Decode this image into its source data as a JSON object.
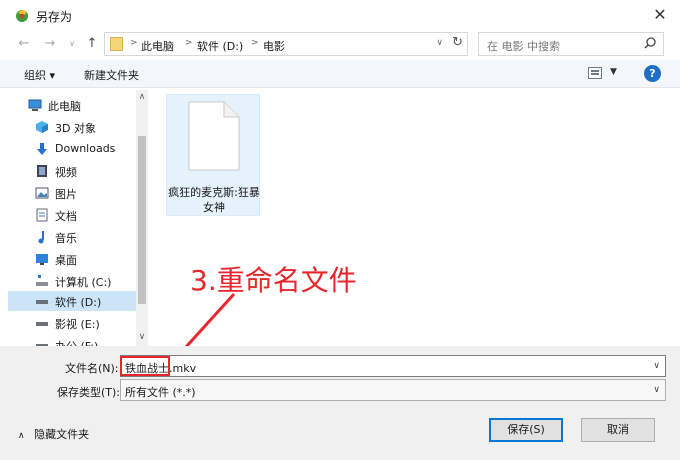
{
  "window": {
    "title": "另存为"
  },
  "address": {
    "crumbs": [
      "此电脑",
      "软件 (D:)",
      "电影"
    ]
  },
  "search": {
    "placeholder": "在 电影 中搜索"
  },
  "toolbar": {
    "organize": "组织 ▾",
    "new_folder": "新建文件夹"
  },
  "sidebar": {
    "items": [
      {
        "label": "此电脑",
        "icon": "computer-icon"
      },
      {
        "label": "3D 对象",
        "icon": "cube-icon"
      },
      {
        "label": "Downloads",
        "icon": "download-arrow-icon"
      },
      {
        "label": "视频",
        "icon": "video-icon"
      },
      {
        "label": "图片",
        "icon": "picture-icon"
      },
      {
        "label": "文档",
        "icon": "document-icon"
      },
      {
        "label": "音乐",
        "icon": "music-note-icon"
      },
      {
        "label": "桌面",
        "icon": "desktop-icon"
      },
      {
        "label": "计算机 (C:)",
        "icon": "drive-c-icon"
      },
      {
        "label": "软件 (D:)",
        "icon": "drive-icon",
        "selected": true
      },
      {
        "label": "影视 (E:)",
        "icon": "drive-icon"
      },
      {
        "label": "办公 (F:)",
        "icon": "drive-icon"
      }
    ]
  },
  "file": {
    "name": "疯狂的麦克斯:狂暴女神"
  },
  "annotation": {
    "text": "3.重命名文件",
    "color": "#e8262b"
  },
  "form": {
    "filename_label": "文件名(N):",
    "filename_value": "铁血战士.mkv",
    "filetype_label": "保存类型(T):",
    "filetype_value": "所有文件 (*.*)"
  },
  "footer": {
    "hide_folders": "隐藏文件夹",
    "save": "保存(S)",
    "cancel": "取消"
  }
}
